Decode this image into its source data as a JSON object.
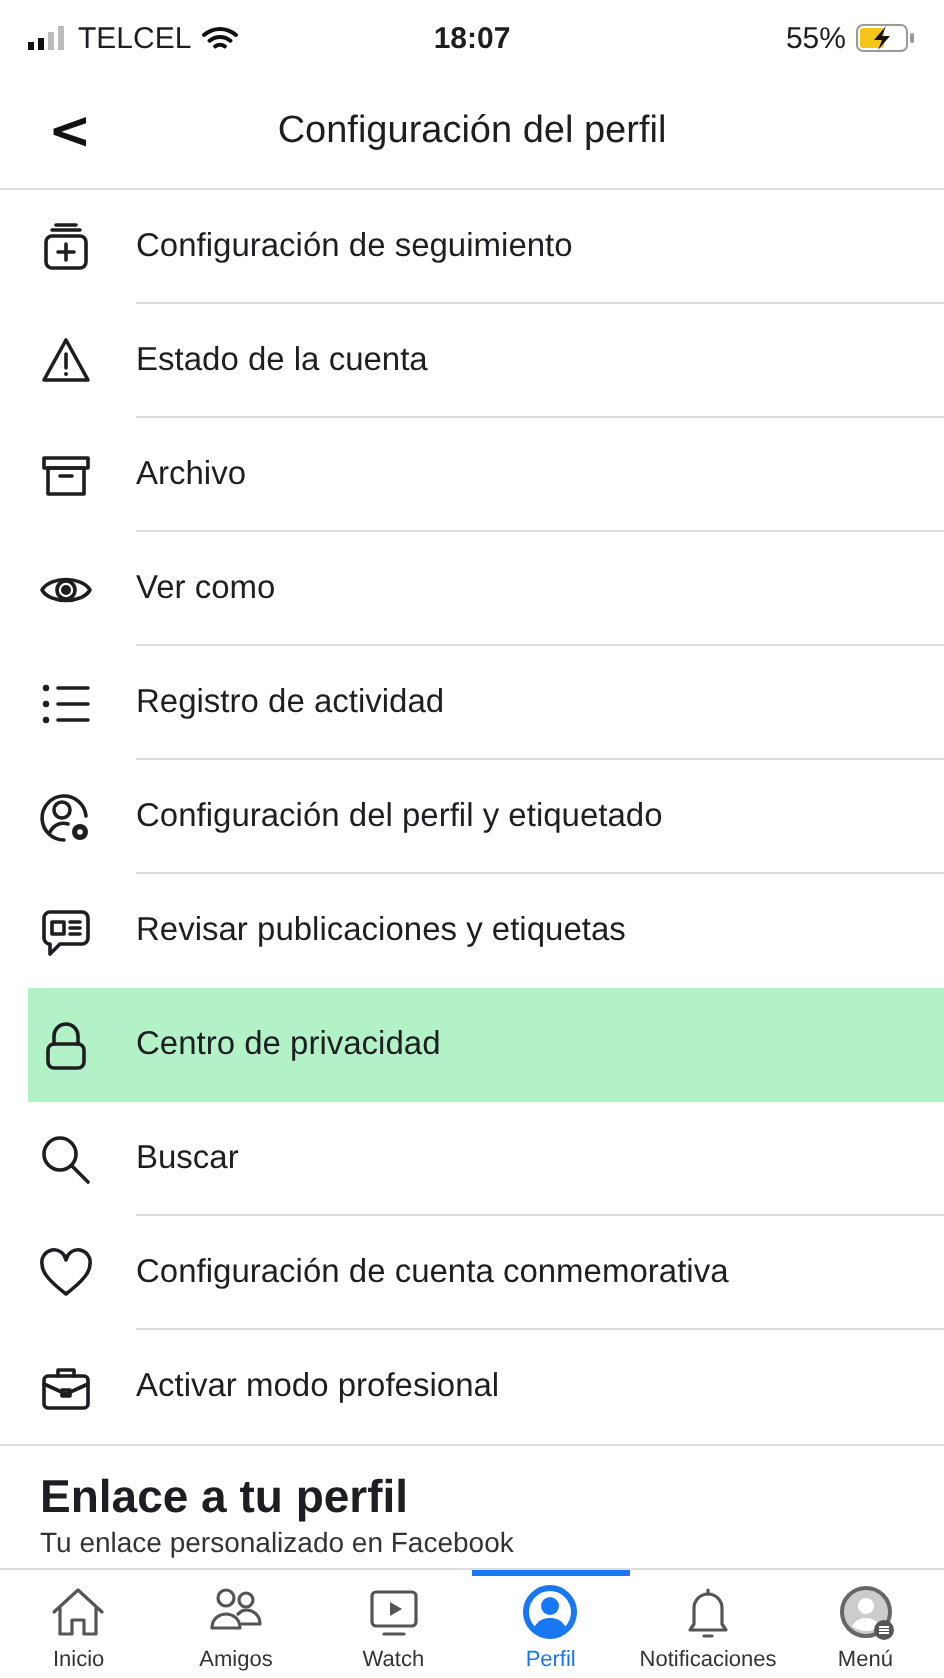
{
  "status_bar": {
    "carrier": "TELCEL",
    "time": "18:07",
    "battery": "55%"
  },
  "header": {
    "back": "<",
    "title": "Configuración del perfil"
  },
  "menu_items": [
    {
      "label": "Configuración de seguimiento",
      "selected": false
    },
    {
      "label": "Estado de la cuenta",
      "selected": false
    },
    {
      "label": "Archivo",
      "selected": false
    },
    {
      "label": "Ver como",
      "selected": false
    },
    {
      "label": "Registro de actividad",
      "selected": false
    },
    {
      "label": "Configuración del perfil y etiquetado",
      "selected": false
    },
    {
      "label": "Revisar publicaciones y etiquetas",
      "selected": false
    },
    {
      "label": "Centro de privacidad",
      "selected": true
    },
    {
      "label": "Buscar",
      "selected": false
    },
    {
      "label": "Configuración de cuenta conmemorativa",
      "selected": false
    },
    {
      "label": "Activar modo profesional",
      "selected": false
    }
  ],
  "link_section": {
    "title": "Enlace a tu perfil",
    "subtitle": "Tu enlace personalizado en Facebook"
  },
  "tab_bar": [
    {
      "label": "Inicio",
      "selected": false
    },
    {
      "label": "Amigos",
      "selected": false
    },
    {
      "label": "Watch",
      "selected": false
    },
    {
      "label": "Perfil",
      "selected": true
    },
    {
      "label": "Notificaciones",
      "selected": false
    },
    {
      "label": "Menú",
      "selected": false
    }
  ]
}
